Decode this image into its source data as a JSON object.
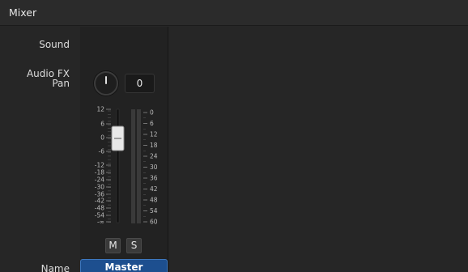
{
  "window": {
    "title": "Mixer"
  },
  "labels": {
    "sound": "Sound",
    "audio_fx_1": "Audio FX",
    "audio_fx_2": "Pan",
    "name": "Name"
  },
  "channel": {
    "pan_value": "0",
    "fader_scale": [
      "12",
      "6",
      "0",
      "-6",
      "-12",
      "-18",
      "-24",
      "-30",
      "-36",
      "-42",
      "-48",
      "-54",
      "-∞"
    ],
    "meter_scale": [
      "0",
      "6",
      "12",
      "18",
      "24",
      "30",
      "36",
      "42",
      "48",
      "54",
      "60"
    ],
    "fader_level_db": 0,
    "mute_label": "M",
    "solo_label": "S",
    "name": "Master"
  }
}
